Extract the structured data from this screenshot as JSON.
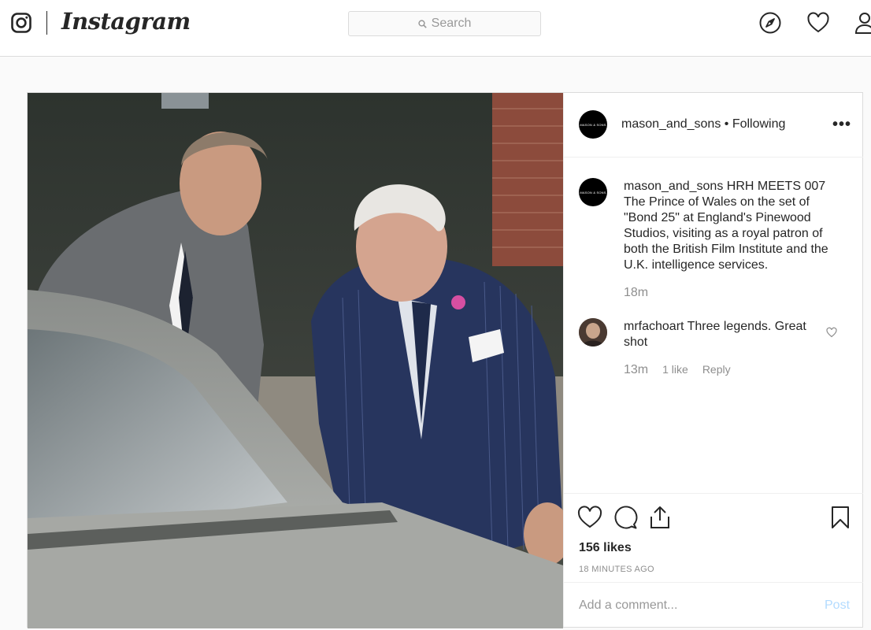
{
  "topbar": {
    "wordmark": "Instagram",
    "search_placeholder": "Search",
    "icons": [
      "instagram-glyph-icon",
      "explore-compass-icon",
      "activity-heart-icon",
      "profile-icon"
    ]
  },
  "post": {
    "account": "mason_and_sons",
    "follow_status": "• Following",
    "avatar_text": "MASON & SONS",
    "caption_user": "mason_and_sons",
    "caption_text": "HRH MEETS 007 The Prince of Wales on the set of \"Bond 25\" at England's Pinewood Studios, visiting as a royal patron of both the British Film Institute and the U.K. intelligence services.",
    "caption_time": "18m",
    "comments": [
      {
        "user": "mrfachoart",
        "text": "Three legends. Great shot",
        "time": "13m",
        "likes": "1 like",
        "reply": "Reply"
      }
    ],
    "likes_count": "156 likes",
    "posted_ago": "18 MINUTES AGO",
    "comment_placeholder": "Add a comment...",
    "post_button": "Post"
  },
  "colors": {
    "text": "#262626",
    "muted": "#8e8e8e",
    "border": "#dbdbdb",
    "post_button_disabled": "#b3dbff"
  }
}
